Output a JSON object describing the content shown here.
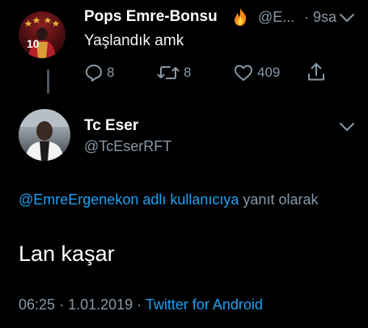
{
  "tweet1": {
    "name": "Pops Emre-Bonsu",
    "name_emoji": "fire",
    "handle": "@E...",
    "separator": "·",
    "time": "9sa",
    "text": "Yaşlandık amk",
    "avatar_number": "10",
    "actions": {
      "replies": "8",
      "retweets": "8",
      "likes": "409"
    }
  },
  "tweet2": {
    "name": "Tc Eser",
    "handle": "@TcEserRFT",
    "reply_to_link": "@EmreErgenekon adlı kullanıcıya",
    "reply_suffix": " yanıt olarak",
    "body": "Lan kaşar",
    "footer_time": "06:25",
    "footer_sep1": "·",
    "footer_date": "1.01.2019",
    "footer_sep2": "·",
    "footer_source": "Twitter for Android"
  },
  "colors": {
    "background": "#000000",
    "muted": "#8899a6",
    "link": "#1da1f2",
    "text": "#ffffff"
  },
  "icons": [
    "reply-icon",
    "retweet-icon",
    "like-icon",
    "share-icon",
    "chevron-down-icon",
    "fire-icon"
  ]
}
